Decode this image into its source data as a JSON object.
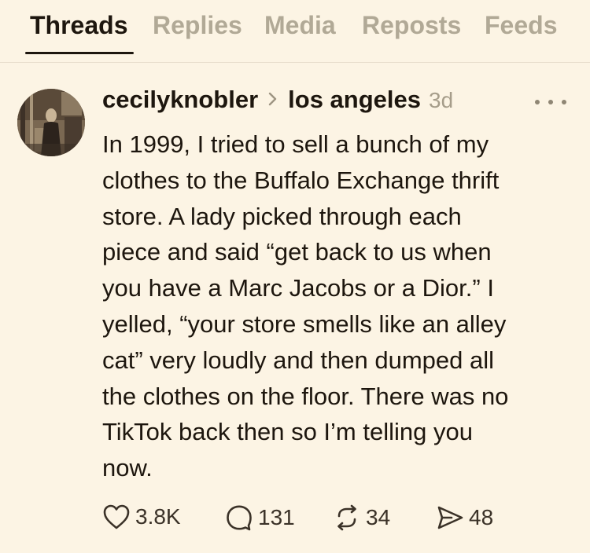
{
  "tabs": [
    {
      "label": "Threads",
      "active": true
    },
    {
      "label": "Replies",
      "active": false
    },
    {
      "label": "Media",
      "active": false
    },
    {
      "label": "Reposts",
      "active": false
    },
    {
      "label": "Feeds",
      "active": false
    }
  ],
  "post": {
    "username": "cecilyknobler",
    "location": "los angeles",
    "time": "3d",
    "avatar_icon": "profile-photo",
    "text": "In 1999, I tried to sell a bunch of my\nclothes to the Buffalo Exchange thrift\nstore. A lady picked through each\npiece and said “get back to us when\nyou have a Marc Jacobs or a Dior.” I\nyelled, “your store smells like an alley\ncat” very loudly and then dumped all\nthe clothes on the floor. There was no\nTikTok back then so I’m telling you\nnow.",
    "actions": {
      "likes": "3.8K",
      "replies": "131",
      "reposts": "34",
      "shares": "48"
    }
  },
  "colors": {
    "background": "#fcf4e4",
    "text": "#1d160e",
    "muted": "#b1a996"
  }
}
